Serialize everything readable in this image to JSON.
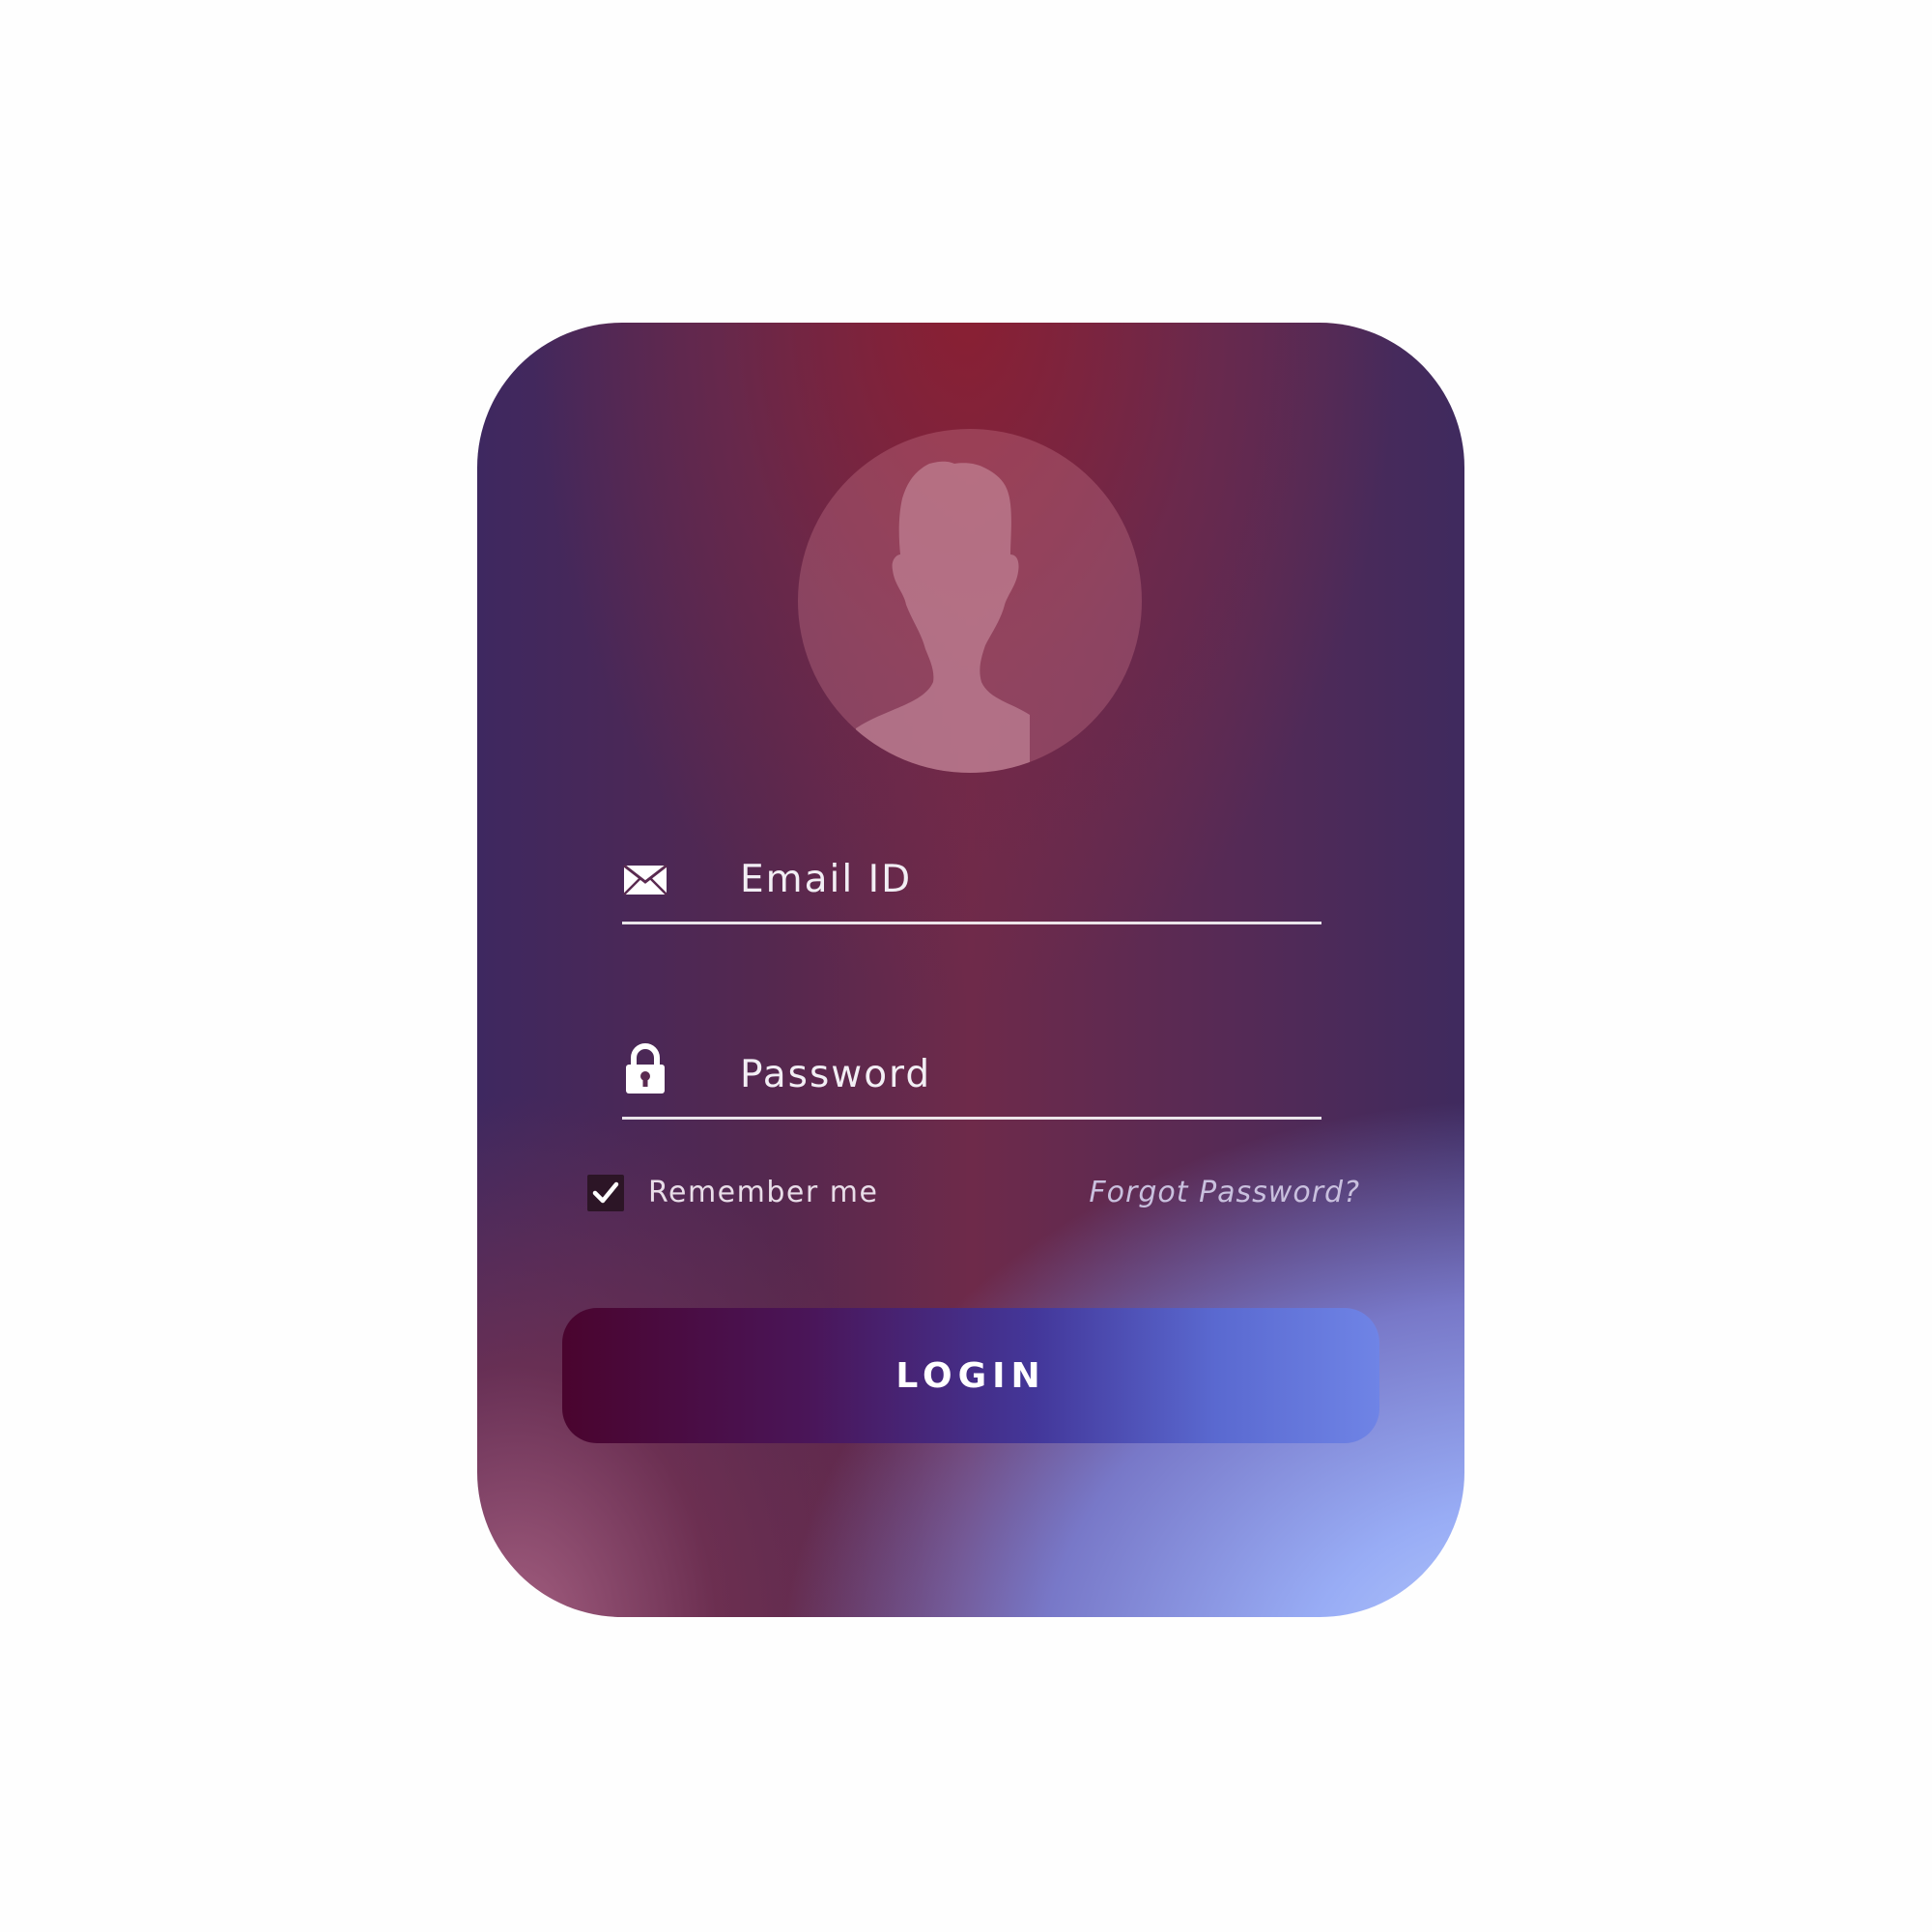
{
  "login_card": {
    "email_placeholder": "Email ID",
    "password_placeholder": "Password",
    "remember_label": "Remember me",
    "remember_checked": true,
    "forgot_label": "Forgot Password?",
    "login_label": "LOGIN"
  },
  "icons": {
    "avatar": "user-silhouette-icon",
    "email": "envelope-icon",
    "password": "lock-icon",
    "checkbox": "checkmark-icon"
  },
  "colors": {
    "page_background": "#fefefe",
    "card_top": "#7e2237",
    "card_left": "#3e2860",
    "card_bottom_right": "#b8cdfd",
    "button_start": "#4a042e",
    "button_end": "#6f84e6",
    "text": "#f2eef4"
  }
}
